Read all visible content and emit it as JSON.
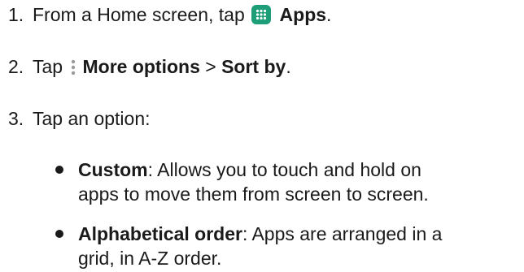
{
  "steps": [
    {
      "number": "1.",
      "prefix": "From a Home screen, tap",
      "icon": "apps-grid-icon",
      "bold": "Apps",
      "suffix": "."
    },
    {
      "number": "2.",
      "prefix": "Tap",
      "icon": "more-options-vertical-dots-icon",
      "bold1": "More options",
      "sep": " > ",
      "bold2": "Sort by",
      "suffix": "."
    },
    {
      "number": "3.",
      "text": "Tap an option:"
    }
  ],
  "options": [
    {
      "label": "Custom",
      "desc_line1": ": Allows you to touch and hold on",
      "desc_line2": "apps to move them from screen to screen."
    },
    {
      "label": "Alphabetical order",
      "desc_line1": ": Apps are arranged in a",
      "desc_line2": "grid, in A-Z order."
    }
  ],
  "colors": {
    "apps_icon_bg": "#1e9e78",
    "text": "#1a1a1a"
  }
}
